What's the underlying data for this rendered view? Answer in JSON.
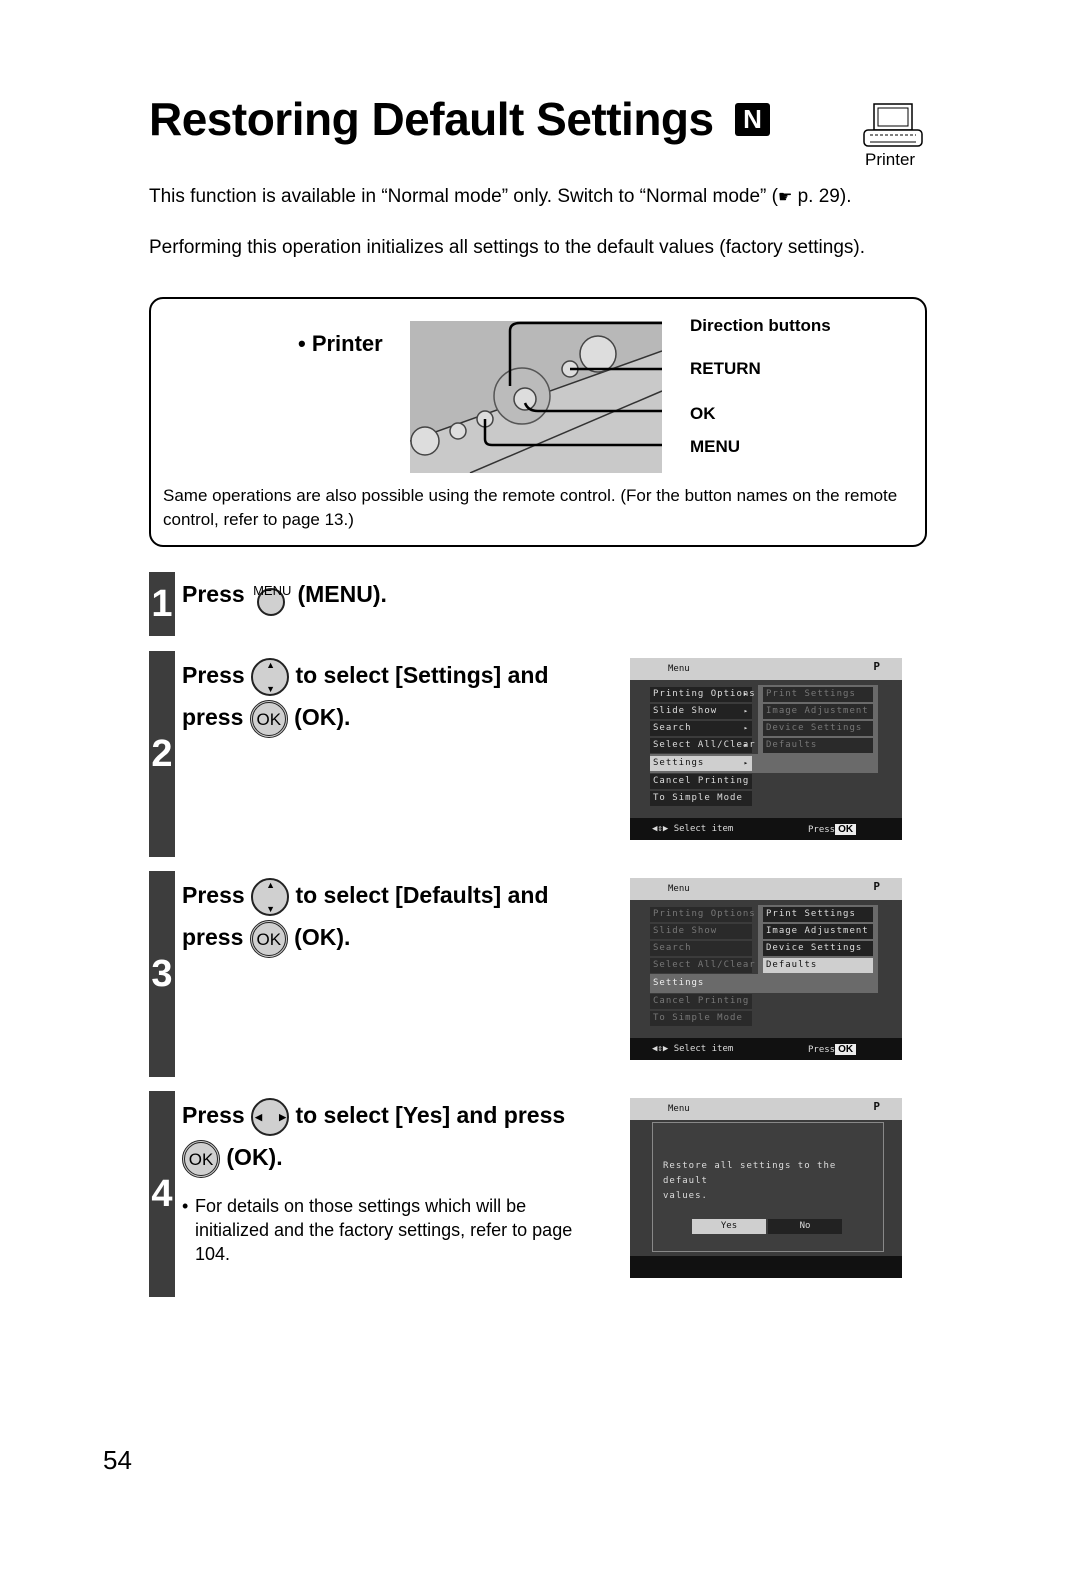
{
  "page": {
    "title": "Restoring Default Settings",
    "mode_badge": "N",
    "device_icon_label": "Printer",
    "intro_line1_before": "This function is available in “Normal mode” only. Switch to “Normal mode” (",
    "intro_line1_after": " p. 29).",
    "intro_line2": "Performing this operation initializes all settings to the default values (factory settings).",
    "page_number": "54"
  },
  "button_box": {
    "heading": "• Printer",
    "callouts": [
      "Direction buttons",
      "RETURN",
      "OK",
      "MENU"
    ],
    "note": "Same operations are also possible using the remote control. (For the button names on the remote control, refer to page 13.)"
  },
  "steps": [
    {
      "number": "1",
      "press": "Press",
      "icon_label": "MENU",
      "after": "(MENU)."
    },
    {
      "number": "2",
      "press": "Press",
      "after": "to select [Settings] and",
      "press2": "press",
      "ok_label": "OK",
      "after2": "(OK).",
      "screen": {
        "header": "Menu",
        "header_icon": "P",
        "left_items": [
          {
            "label": "Printing Options",
            "arrow": "▸"
          },
          {
            "label": "Slide Show",
            "arrow": "▸"
          },
          {
            "label": "Search",
            "arrow": "▸"
          },
          {
            "label": "Select All/Clear",
            "arrow": "▸"
          },
          {
            "label": "Settings",
            "arrow": "▸"
          },
          {
            "label": "Cancel Printing",
            "arrow": ""
          },
          {
            "label": "To Simple Mode",
            "arrow": ""
          }
        ],
        "right_items": [
          "Print Settings",
          "Image Adjustment",
          "Device Settings",
          "Defaults"
        ],
        "footer_hint": "Select item",
        "footer_press": "Press",
        "footer_ok": "OK"
      }
    },
    {
      "number": "3",
      "press": "Press",
      "after": "to select [Defaults] and",
      "press2": "press",
      "ok_label": "OK",
      "after2": "(OK).",
      "screen": {
        "header": "Menu",
        "header_icon": "P",
        "left_items": [
          "Printing Options",
          "Slide Show",
          "Search",
          "Select All/Clear",
          "Settings",
          "Cancel Printing",
          "To Simple Mode"
        ],
        "right_items": [
          "Print Settings",
          "Image Adjustment",
          "Device Settings",
          "Defaults"
        ],
        "footer_hint": "Select item",
        "footer_press": "Press",
        "footer_ok": "OK"
      }
    },
    {
      "number": "4",
      "press": "Press",
      "after": "to select [Yes] and press",
      "ok_label": "OK",
      "after2": "(OK).",
      "note": "For details on those settings which will be initialized and the factory settings, refer to page 104.",
      "screen": {
        "header": "Menu",
        "header_icon": "P",
        "message_line1": "Restore all settings to the default",
        "message_line2": "values.",
        "yes": "Yes",
        "no": "No"
      }
    }
  ]
}
